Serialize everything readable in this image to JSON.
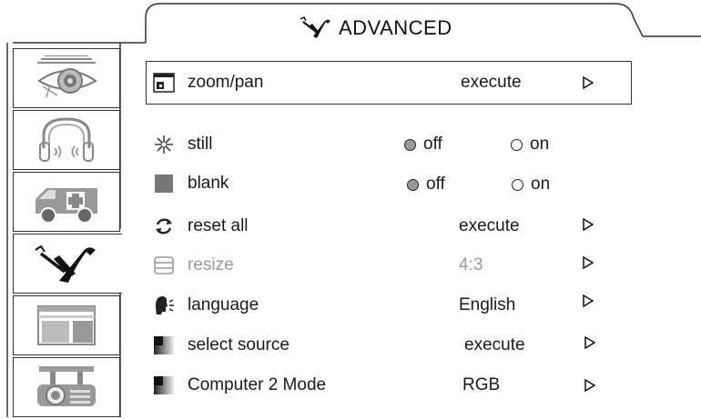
{
  "header": {
    "title": "ADVANCED",
    "icon": "tools-icon"
  },
  "sidebar": {
    "tabs": [
      {
        "name": "picture",
        "icon": "eye-icon",
        "active": false
      },
      {
        "name": "audio",
        "icon": "headphones-icon",
        "active": false
      },
      {
        "name": "service",
        "icon": "ambulance-icon",
        "active": false
      },
      {
        "name": "advanced",
        "icon": "tools-icon",
        "active": true
      },
      {
        "name": "layout",
        "icon": "window-layout-icon",
        "active": false
      },
      {
        "name": "projector",
        "icon": "projector-icon",
        "active": false
      }
    ]
  },
  "menu": {
    "zoom_pan": {
      "label": "zoom/pan",
      "value": "execute",
      "icon": "zoom-pan-icon"
    },
    "still": {
      "label": "still",
      "icon": "snowflake-icon",
      "off": "off",
      "on": "on",
      "selected": "off"
    },
    "blank": {
      "label": "blank",
      "icon": "blank-square-icon",
      "off": "off",
      "on": "on",
      "selected": "off"
    },
    "reset_all": {
      "label": "reset all",
      "value": "execute",
      "icon": "refresh-icon"
    },
    "resize": {
      "label": "resize",
      "value": "4:3",
      "icon": "resize-icon"
    },
    "language": {
      "label": "language",
      "value": "English",
      "icon": "speaking-head-icon"
    },
    "select_source": {
      "label": "select source",
      "value": "execute",
      "icon": "source-icon"
    },
    "computer2_mode": {
      "label": "Computer 2 Mode",
      "value": "RGB",
      "icon": "source-icon"
    }
  }
}
